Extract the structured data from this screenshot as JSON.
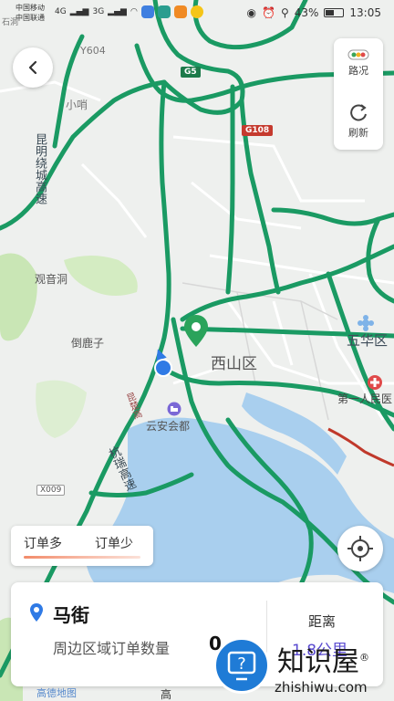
{
  "status_bar": {
    "carrier_1": "中国移动",
    "carrier_2": "中国联通",
    "signal_1": "4G",
    "signal_2": "3G",
    "battery_percent": "43%",
    "battery_level": 0.43,
    "time": "13:05"
  },
  "right_panel": {
    "traffic_label": "路况",
    "refresh_label": "刷新"
  },
  "map": {
    "labels": {
      "y604": "Y604",
      "xiaoshao": "小哨",
      "kunming_road": "昆明绕城高速",
      "guanyindong": "观音洞",
      "daopaozi": "倒鹿子",
      "xishan": "西山区",
      "wuhua": "五华区",
      "hospital": "第一人民医",
      "yunan": "云安会都",
      "x009": "X009",
      "hangrui": "杭瑞高速",
      "kunchu": "昆楚高",
      "corner_top_left": "石洞"
    },
    "shields": {
      "g5": "G5",
      "g108": "G108"
    }
  },
  "legend": {
    "more": "订单多",
    "less": "订单少"
  },
  "card": {
    "place": "马街",
    "orders_label": "周边区域订单数量",
    "orders_count": "0",
    "distance_label": "距离",
    "distance_value": "1.8公里"
  },
  "watermark": {
    "title": "知识屋",
    "domain": "zhishiwu.com",
    "registered": "®"
  },
  "map_brand": "高德地图",
  "map_corner": "高",
  "colors": {
    "road": "#1a9a63",
    "accent": "#5a4bd0",
    "location": "#2f7ae5",
    "pin": "#2aa35b"
  }
}
